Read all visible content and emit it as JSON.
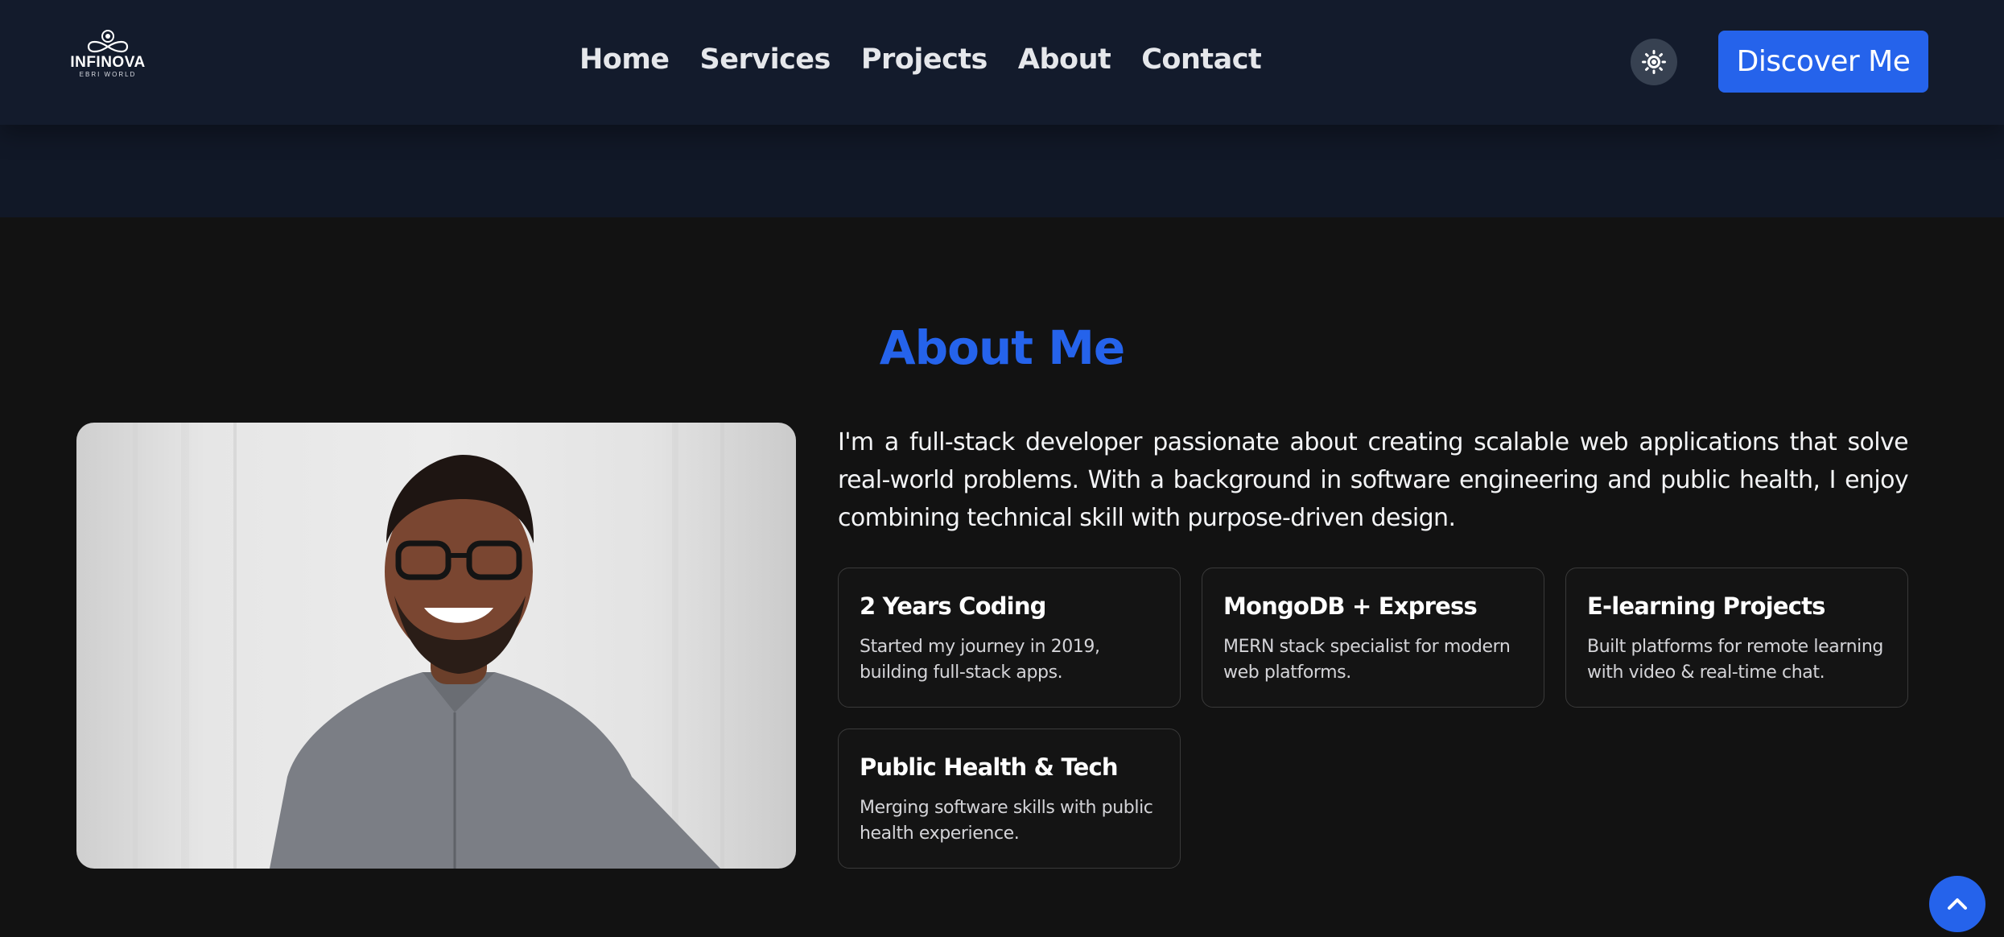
{
  "header": {
    "logo": {
      "name": "INFINOVA",
      "tagline": "EBRI WORLD",
      "icon": "infinity-logo-icon"
    },
    "nav": [
      {
        "label": "Home"
      },
      {
        "label": "Services"
      },
      {
        "label": "Projects"
      },
      {
        "label": "About"
      },
      {
        "label": "Contact"
      }
    ],
    "theme_toggle_icon": "sun-icon",
    "cta_label": "Discover Me"
  },
  "about": {
    "title": "About Me",
    "photo": {
      "subject": "portrait-photo",
      "alt": ""
    },
    "bio": "I'm a full-stack developer passionate about creating scalable web applications that solve real-world problems. With a background in software engineering and public health, I enjoy combining technical skill with purpose-driven design.",
    "cards": [
      {
        "title": "2 Years Coding",
        "description": "Started my journey in 2019, building full-stack apps."
      },
      {
        "title": "MongoDB + Express",
        "description": "MERN stack specialist for modern web platforms."
      },
      {
        "title": "E-learning Projects",
        "description": "Built platforms for remote learning with video & real-time chat."
      },
      {
        "title": "Public Health & Tech",
        "description": "Merging software skills with public health experience."
      }
    ]
  },
  "scroll_top_icon": "chevron-up-icon",
  "colors": {
    "accent": "#2563eb",
    "navbar_bg": "#131b2c",
    "page_bg": "#121212",
    "card_border": "#3a3a3a"
  }
}
